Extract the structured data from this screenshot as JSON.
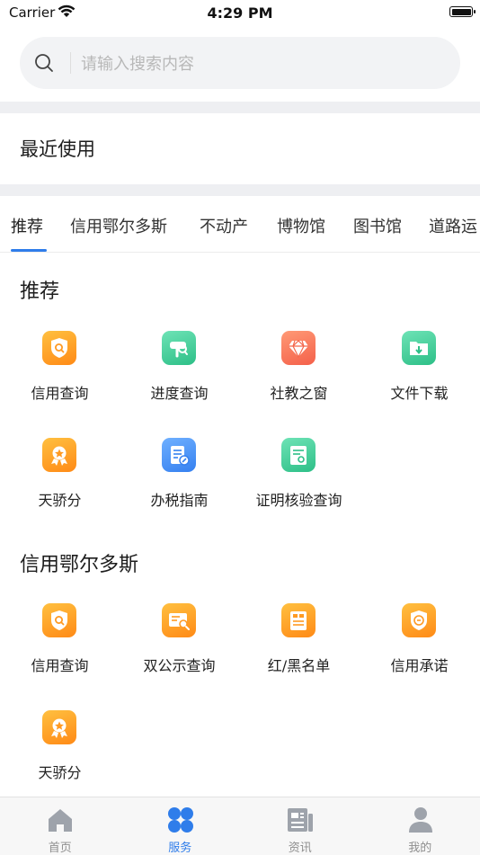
{
  "status_bar": {
    "carrier": "Carrier",
    "time": "4:29 PM"
  },
  "search": {
    "placeholder": "请输入搜索内容",
    "value": ""
  },
  "recent": {
    "title": "最近使用"
  },
  "tabs": [
    {
      "label": "推荐",
      "active": true
    },
    {
      "label": "信用鄂尔多斯"
    },
    {
      "label": "不动产"
    },
    {
      "label": "博物馆"
    },
    {
      "label": "图书馆"
    },
    {
      "label": "道路运"
    }
  ],
  "sections": [
    {
      "title": "推荐",
      "items": [
        {
          "label": "信用查询",
          "icon": "shield-search-icon",
          "color": "#ff9f25"
        },
        {
          "label": "进度查询",
          "icon": "magnifier-card-icon",
          "color": "#3fcf99"
        },
        {
          "label": "社教之窗",
          "icon": "diamond-icon",
          "color": "#f86e50"
        },
        {
          "label": "文件下载",
          "icon": "folder-download-icon",
          "color": "#3fcf99"
        },
        {
          "label": "天骄分",
          "icon": "medal-icon",
          "color": "#ff9f25"
        },
        {
          "label": "办税指南",
          "icon": "tax-document-icon",
          "color": "#4a93f7"
        },
        {
          "label": "证明核验查询",
          "icon": "certificate-icon",
          "color": "#3fcf99"
        }
      ]
    },
    {
      "title": "信用鄂尔多斯",
      "items": [
        {
          "label": "信用查询",
          "icon": "shield-search-icon",
          "color": "#ff9f25"
        },
        {
          "label": "双公示查询",
          "icon": "announcement-search-icon",
          "color": "#ff9f25"
        },
        {
          "label": "红/黑名单",
          "icon": "list-board-icon",
          "color": "#ff9f25"
        },
        {
          "label": "信用承诺",
          "icon": "promise-shield-icon",
          "color": "#ff9f25"
        },
        {
          "label": "天骄分",
          "icon": "medal-icon",
          "color": "#ff9f25"
        }
      ]
    }
  ],
  "tabbar": [
    {
      "label": "首页",
      "icon": "home-icon"
    },
    {
      "label": "服务",
      "icon": "services-grid-icon",
      "active": true
    },
    {
      "label": "资讯",
      "icon": "news-icon"
    },
    {
      "label": "我的",
      "icon": "profile-icon"
    }
  ],
  "colors": {
    "accent": "#2f7dea",
    "inactive": "#8f8f8f"
  }
}
